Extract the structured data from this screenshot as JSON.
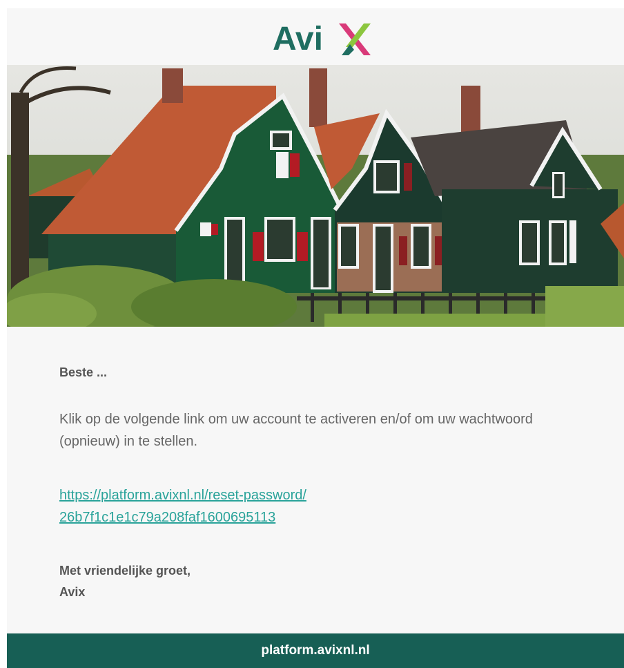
{
  "brand": {
    "name": "Avix",
    "logo_text": "Avi",
    "colors": {
      "primary": "#1f6e61",
      "accent_pink": "#d93a79",
      "accent_green": "#8cc63f",
      "footer": "#175f55",
      "link": "#2aa39a"
    }
  },
  "hero": {
    "icon": "dutch-houses-photo"
  },
  "message": {
    "greeting": "Beste ...",
    "body": "Klik op de volgende link om uw account te activeren en/of om uw wachtwoord (opnieuw) in te stellen.",
    "link_line1": "https://platform.avixnl.nl/reset-password/",
    "link_line2": "26b7f1c1e1c79a208faf1600695113",
    "signoff_line1": "Met vriendelijke groet,",
    "signoff_line2": "Avix"
  },
  "footer": {
    "link_text": "platform.avixnl.nl"
  }
}
